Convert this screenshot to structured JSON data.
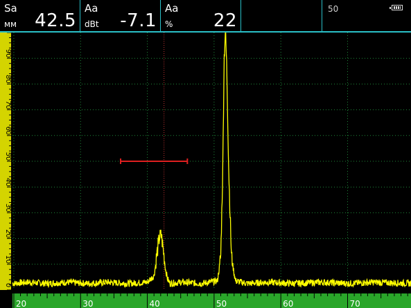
{
  "header": {
    "readouts": [
      {
        "label": "Sa",
        "unit": "мм",
        "value": "42.5"
      },
      {
        "label": "Aa",
        "unit": "dBt",
        "value": "-7.1"
      },
      {
        "label": "Aa",
        "unit": "%",
        "value": "22"
      }
    ],
    "range_indicator": "50",
    "battery_icon": "battery-icon"
  },
  "colors": {
    "background": "#000000",
    "grid": "#1f8a3a",
    "scale_bar": "#d4d400",
    "bottom_bar": "#2aa62a",
    "trace": "#ffff00",
    "gate": "#e02020",
    "cursor": "#c03030",
    "header_border": "#2ac0c8"
  },
  "chart_data": {
    "type": "line",
    "title": "",
    "xlabel": "",
    "ylabel": "",
    "x_ticks": [
      20,
      30,
      40,
      50,
      60,
      70
    ],
    "x_tick_labels": [
      "20",
      "30",
      "40",
      "50",
      "60",
      "70"
    ],
    "xlim": [
      19.8,
      79.5
    ],
    "y_ticks": [
      0,
      10,
      20,
      30,
      40,
      50,
      60,
      70,
      80,
      90
    ],
    "y_tick_labels": [
      "0",
      "10",
      "20",
      "30",
      "40",
      "50",
      "60",
      "70",
      "80",
      "90"
    ],
    "ylim": [
      0,
      100
    ],
    "grid": true,
    "cursor_x": 42.5,
    "gate": {
      "x_start": 36.0,
      "x_end": 46.0,
      "level": 50
    },
    "series": [
      {
        "x": [
          19.8,
          22,
          25,
          28,
          31,
          34,
          37,
          40,
          41.0,
          41.4,
          41.8,
          42.1,
          42.4,
          42.7,
          43.0,
          43.4,
          45,
          48,
          50.5,
          51.0,
          51.3,
          51.5,
          51.7,
          51.9,
          52.2,
          52.6,
          53.2,
          55,
          58,
          62,
          66,
          70,
          74,
          79.5
        ],
        "y": [
          2,
          2.5,
          2,
          2.5,
          2,
          2.5,
          2,
          2.5,
          5,
          12,
          19,
          20,
          14,
          8,
          4,
          2,
          2.5,
          2,
          3,
          12,
          45,
          88,
          100,
          85,
          45,
          12,
          3,
          2,
          2.5,
          2,
          2.5,
          2,
          2.5,
          2
        ]
      }
    ]
  }
}
